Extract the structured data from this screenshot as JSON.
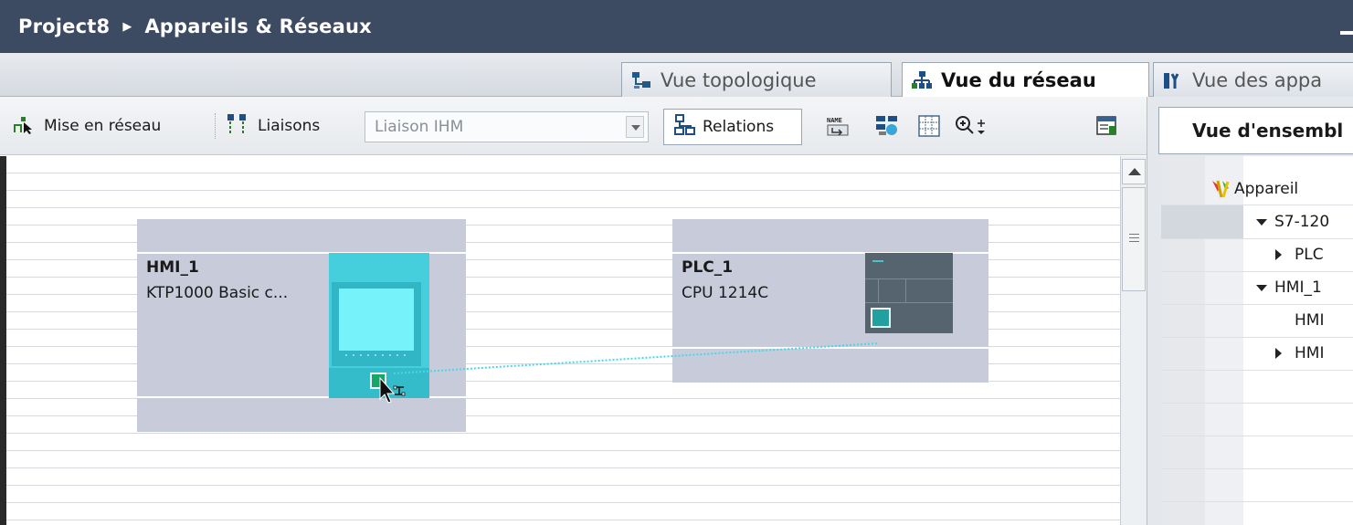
{
  "breadcrumb": {
    "project": "Project8",
    "separator": "▶",
    "page": "Appareils & Réseaux"
  },
  "tabs": [
    {
      "label": "Vue topologique",
      "active": false
    },
    {
      "label": "Vue du réseau",
      "active": true
    },
    {
      "label": "Vue des appa",
      "active": false
    }
  ],
  "toolbar": {
    "network_label": "Mise en réseau",
    "connections_label": "Liaisons",
    "connection_type_value": "Liaison IHM",
    "relations_label": "Relations"
  },
  "devices": {
    "hmi": {
      "name": "HMI_1",
      "type": "KTP1000 Basic c..."
    },
    "plc": {
      "name": "PLC_1",
      "type": "CPU 1214C"
    }
  },
  "overview": {
    "title": "Vue d'ensembl",
    "column_header": "Appareil",
    "rows": [
      {
        "label": "S7-120",
        "expand": "down"
      },
      {
        "label": "PLC",
        "expand": "right"
      },
      {
        "label": "HMI_1",
        "expand": "down"
      },
      {
        "label": "HMI",
        "expand": "none"
      },
      {
        "label": "HMI",
        "expand": "right"
      }
    ]
  },
  "colors": {
    "title_bar": "#3c4b61",
    "device_box": "#c8ccda",
    "hmi_accent": "#45cfdc",
    "connection_line": "#46d8e6"
  }
}
